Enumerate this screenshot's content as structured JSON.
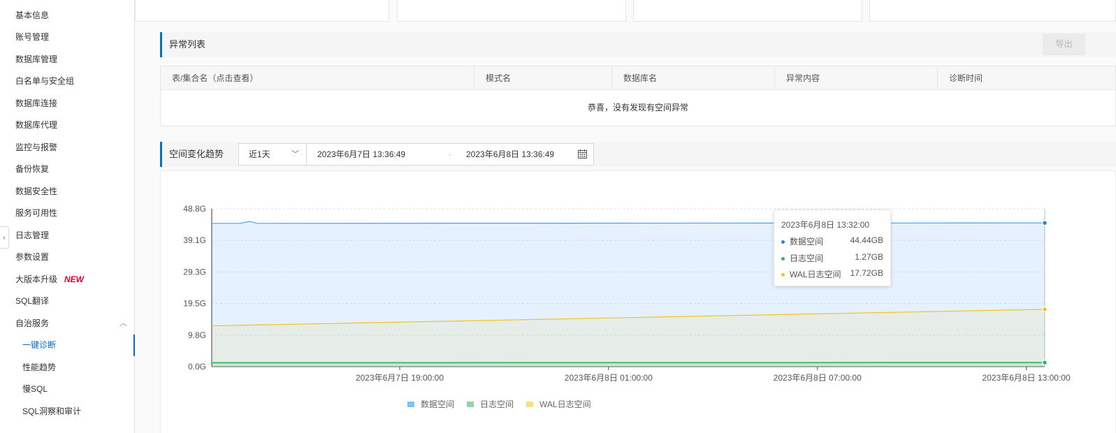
{
  "sidebar": {
    "items": [
      {
        "label": "基本信息"
      },
      {
        "label": "账号管理"
      },
      {
        "label": "数据库管理"
      },
      {
        "label": "白名单与安全组"
      },
      {
        "label": "数据库连接"
      },
      {
        "label": "数据库代理"
      },
      {
        "label": "监控与报警"
      },
      {
        "label": "备份恢复"
      },
      {
        "label": "数据安全性"
      },
      {
        "label": "服务可用性"
      },
      {
        "label": "日志管理"
      },
      {
        "label": "参数设置"
      },
      {
        "label": "大版本升级",
        "badge": "NEW"
      },
      {
        "label": "SQL翻译"
      },
      {
        "label": "自治服务"
      }
    ],
    "subitems": [
      {
        "label": "一键诊断",
        "active": true
      },
      {
        "label": "性能趋势"
      },
      {
        "label": "慢SQL"
      },
      {
        "label": "SQL洞察和审计"
      }
    ]
  },
  "anomaly": {
    "title": "异常列表",
    "export_label": "导出",
    "columns": [
      "表/集合名（点击查看）",
      "模式名",
      "数据库名",
      "异常内容",
      "诊断时间"
    ],
    "empty_text": "恭喜，没有发现有空间异常"
  },
  "trend": {
    "title": "空间变化趋势",
    "range_option": "近1天",
    "start_time": "2023年6月7日 13:36:49",
    "end_time": "2023年6月8日 13:36:49",
    "separator": "-"
  },
  "tooltip": {
    "time": "2023年6月8日 13:32:00",
    "rows": [
      {
        "name": "数据空间",
        "value": "44.44GB"
      },
      {
        "name": "日志空间",
        "value": "1.27GB"
      },
      {
        "name": "WAL日志空间",
        "value": "17.72GB"
      }
    ]
  },
  "chart_data": {
    "type": "area",
    "x_ticks": [
      "2023年6月7日 19:00:00",
      "2023年6月8日 01:00:00",
      "2023年6月8日 07:00:00",
      "2023年6月8日 13:00:00"
    ],
    "y_ticks": [
      "48.8G",
      "39.1G",
      "29.3G",
      "19.5G",
      "9.8G",
      "0.0G"
    ],
    "ylim": [
      0,
      48.8
    ],
    "xlim_hours": [
      13.6,
      37.53
    ],
    "series": [
      {
        "name": "数据空间",
        "color": "#4a9ff5",
        "points": [
          [
            13.6,
            44.3
          ],
          [
            14.4,
            44.3
          ],
          [
            14.7,
            44.9
          ],
          [
            14.9,
            44.3
          ],
          [
            37.53,
            44.44
          ]
        ]
      },
      {
        "name": "日志空间",
        "color": "#3fbf6a",
        "points": [
          [
            13.6,
            1.2
          ],
          [
            37.53,
            1.27
          ]
        ]
      },
      {
        "name": "WAL日志空间",
        "color": "#f5c31d",
        "points": [
          [
            13.6,
            12.6
          ],
          [
            37.53,
            17.72
          ]
        ]
      }
    ],
    "legend_position": "bottom-center",
    "grid": true
  }
}
